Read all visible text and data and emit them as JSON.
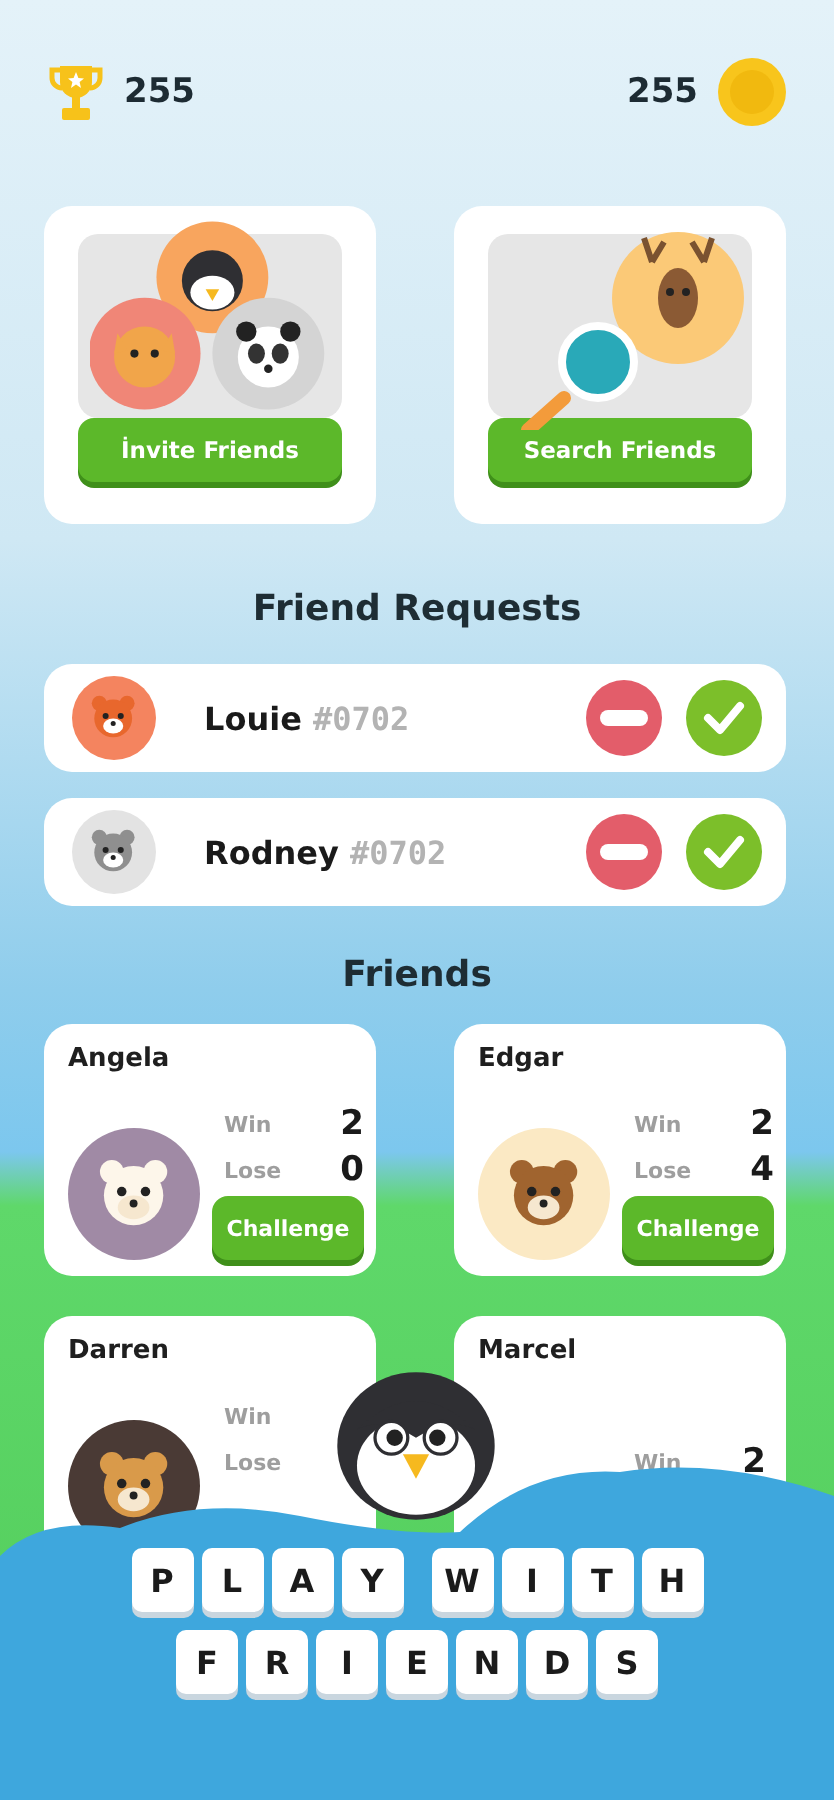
{
  "header": {
    "trophies": "255",
    "coins": "255"
  },
  "actions": [
    {
      "kind": "invite",
      "label": "İnvite Friends"
    },
    {
      "kind": "search",
      "label": "Search Friends"
    }
  ],
  "requests_title": "Friend Requests",
  "requests": [
    {
      "name": "Louie",
      "tag": "#0702",
      "color": "#f4845f"
    },
    {
      "name": "Rodney",
      "tag": "#0702",
      "color": "#e3e3e3"
    }
  ],
  "friends_title": "Friends",
  "friends": [
    {
      "name": "Angela",
      "win_label": "Win",
      "win": "2",
      "lose_label": "Lose",
      "lose": "0",
      "button": "Challenge",
      "color": "#a08aa5"
    },
    {
      "name": "Edgar",
      "win_label": "Win",
      "win": "2",
      "lose_label": "Lose",
      "lose": "4",
      "button": "Challenge",
      "color": "#fbe9c4"
    },
    {
      "name": "Darren",
      "win_label": "Win",
      "lose_label": "Lose",
      "color": "#4a3a35"
    },
    {
      "name": "Marcel",
      "win_label": "Win",
      "win": "2"
    }
  ],
  "banner": {
    "rows": [
      [
        [
          "P",
          "L",
          "A",
          "Y"
        ],
        [
          "W",
          "I",
          "T",
          "H"
        ]
      ],
      [
        [
          "F",
          "R",
          "I",
          "E",
          "N",
          "D",
          "S"
        ]
      ]
    ]
  }
}
